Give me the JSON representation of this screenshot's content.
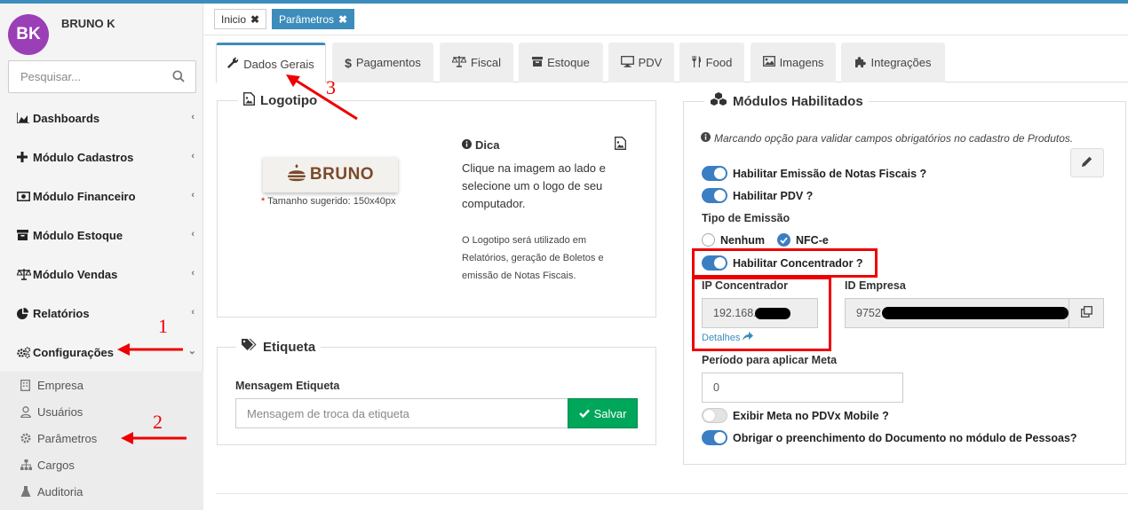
{
  "user": {
    "initials": "BK",
    "name": "BRUNO K"
  },
  "search": {
    "placeholder": "Pesquisar..."
  },
  "sidebar": {
    "items": [
      {
        "label": "Dashboards",
        "icon": "area-chart-icon"
      },
      {
        "label": "Módulo Cadastros",
        "icon": "plus-icon"
      },
      {
        "label": "Módulo Financeiro",
        "icon": "money-icon"
      },
      {
        "label": "Módulo Estoque",
        "icon": "archive-icon"
      },
      {
        "label": "Módulo Vendas",
        "icon": "balance-scale-icon"
      },
      {
        "label": "Relatórios",
        "icon": "pie-chart-icon"
      },
      {
        "label": "Configurações",
        "icon": "gears-icon"
      }
    ],
    "submenu": [
      {
        "label": "Empresa",
        "icon": "building-icon"
      },
      {
        "label": "Usuários",
        "icon": "user-icon"
      },
      {
        "label": "Parâmetros",
        "icon": "gear-icon"
      },
      {
        "label": "Cargos",
        "icon": "sitemap-icon"
      },
      {
        "label": "Auditoria",
        "icon": "flask-icon"
      }
    ]
  },
  "breadcrumbs": [
    {
      "label": "Inicio"
    },
    {
      "label": "Parâmetros"
    }
  ],
  "tabs": [
    {
      "label": "Dados Gerais",
      "icon": "wrench-icon"
    },
    {
      "label": "Pagamentos",
      "icon": "dollar-icon"
    },
    {
      "label": "Fiscal",
      "icon": "balance-scale-icon"
    },
    {
      "label": "Estoque",
      "icon": "archive-icon"
    },
    {
      "label": "PDV",
      "icon": "desktop-icon"
    },
    {
      "label": "Food",
      "icon": "cutlery-icon"
    },
    {
      "label": "Imagens",
      "icon": "image-icon"
    },
    {
      "label": "Integrações",
      "icon": "puzzle-icon"
    }
  ],
  "logotipo": {
    "title": "Logotipo",
    "logo_text": "BRUNO",
    "required_mark": "*",
    "size_hint": "Tamanho sugerido: 150x40px",
    "dica_title": "Dica",
    "dica_text": "Clique na imagem ao lado e selecione um o logo de seu computador.",
    "dica_note": "O Logotipo será utilizado em Relatórios, geração de Boletos e emissão de Notas Fiscais."
  },
  "etiqueta": {
    "title": "Etiqueta",
    "field_label": "Mensagem Etiqueta",
    "placeholder": "Mensagem de troca da etiqueta",
    "save_label": "Salvar"
  },
  "modulos": {
    "title": "Módulos Habilitados",
    "info": "Marcando opção para validar campos obrigatórios no cadastro de Produtos.",
    "toggle_notas": "Habilitar Emissão de Notas Fiscais ?",
    "toggle_pdv": "Habilitar PDV ?",
    "tipo_emissao_label": "Tipo de Emissão",
    "radio_nenhum": "Nenhum",
    "radio_nfce": "NFC-e",
    "toggle_concentrador": "Habilitar Concentrador ?",
    "ip_label": "IP Concentrador",
    "ip_value": "192.168.",
    "id_label": "ID Empresa",
    "id_value": "9752",
    "detalhes_link": "Detalhes",
    "periodo_label": "Período para aplicar Meta",
    "periodo_value": "0",
    "toggle_meta": "Exibir Meta no PDVx Mobile ?",
    "toggle_documento": "Obrigar o preenchimento do Documento no módulo de Pessoas?"
  },
  "toggles_state": {
    "notas": true,
    "pdv": true,
    "concentrador": true,
    "meta": false,
    "documento": true
  },
  "annotations": [
    "1",
    "2",
    "3"
  ],
  "colors": {
    "accent": "#3c8dbc",
    "avatar": "#9b3fb6",
    "success": "#00a65a",
    "annotation": "#e00000",
    "toggle_on": "#3c7ec3"
  }
}
